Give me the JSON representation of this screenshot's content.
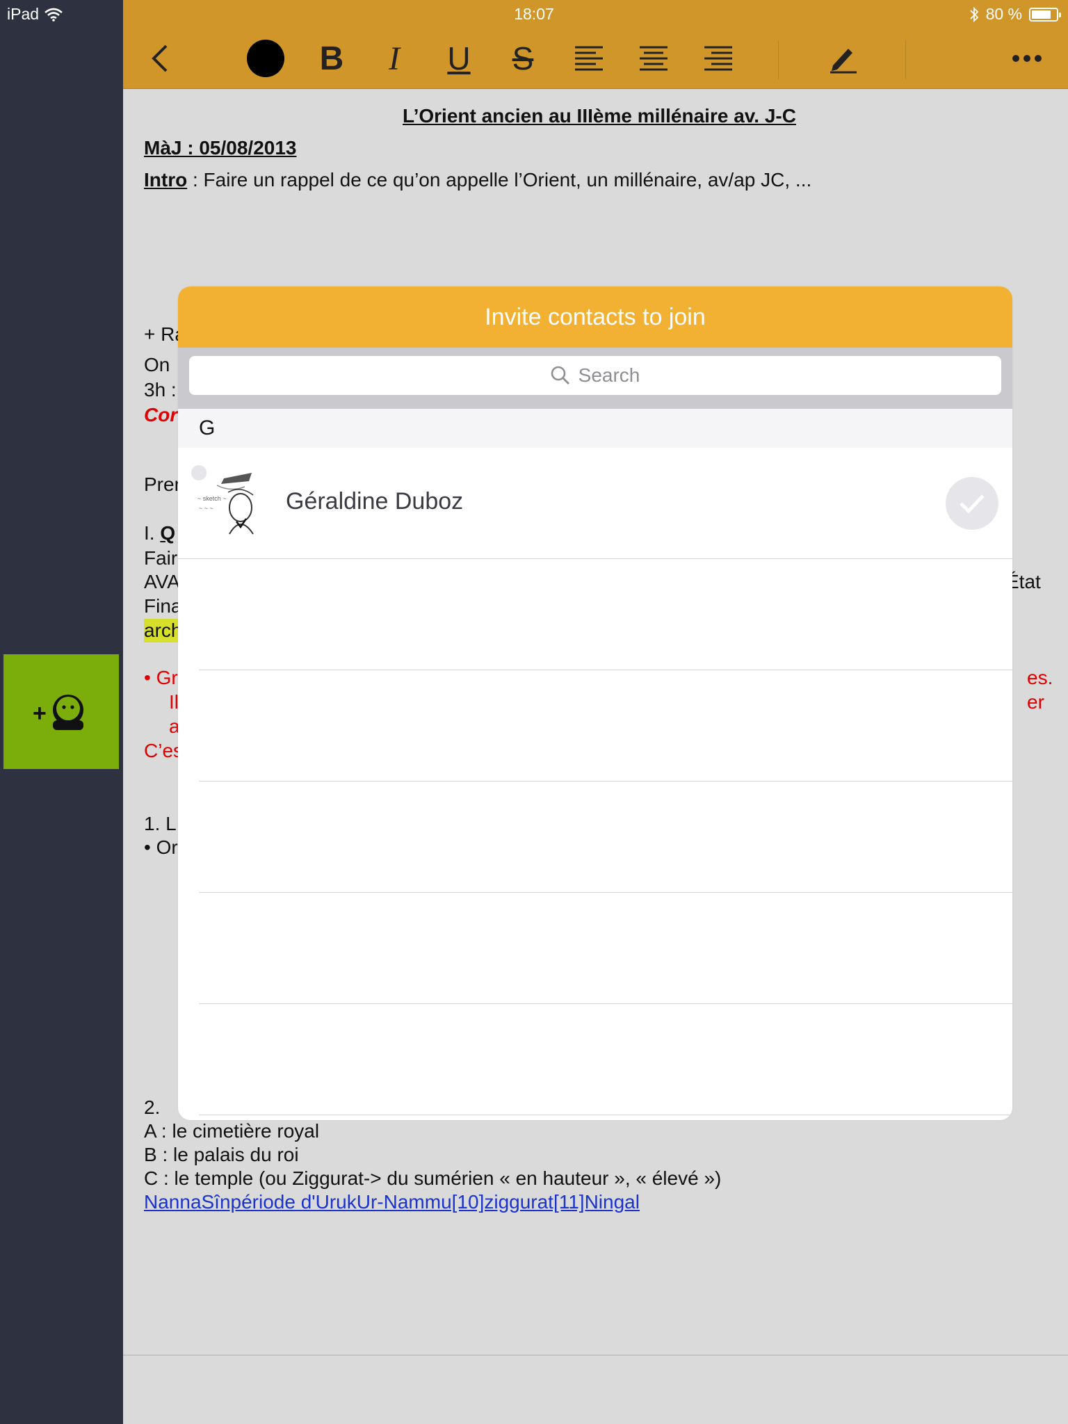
{
  "statusbar": {
    "carrier": "iPad",
    "time": "18:07",
    "battery_text": "80 %",
    "battery_level": 0.8
  },
  "toolbar": {
    "back_icon": "chevron-left-icon",
    "color_icon": "color-circle-icon",
    "bold_label": "B",
    "italic_label": "I",
    "underline_label": "U",
    "strike_label": "S",
    "align_left_icon": "align-left-icon",
    "align_center_icon": "align-center-icon",
    "align_right_icon": "align-right-icon",
    "pen_icon": "pen-icon",
    "more_icon": "more-icon"
  },
  "sidebar": {
    "invite_icon": "add-contact-icon",
    "accent": "#7bad0b"
  },
  "document": {
    "title": "L’Orient ancien au IIIème millénaire av. J-C",
    "update_label": "MàJ : 05/08/2013",
    "intro_label": "Intro",
    "intro_text": " : Faire un rappel de ce qu’on appelle l’Orient, un millénaire, av/ap JC, ...",
    "frag_ra": "+ Ra",
    "frag_on": "On",
    "frag_3h": "3h :",
    "frag_cor": "Cor",
    "frag_prem": "Prem",
    "frag_i": "I. ",
    "frag_q": "Q",
    "frag_fair": "Fair",
    "frag_ava": "AVA",
    "frag_etat": "État",
    "frag_fina": "Fina",
    "frag_arch": "arch",
    "frag_gr": "• Gr",
    "frag_es": "es.",
    "frag_il": "Il",
    "frag_er": "er",
    "frag_a": "a",
    "frag_cest": "C’es",
    "frag_1l": "1. L",
    "frag_or": "• Or",
    "item_2": "2.",
    "item_a": "A : le cimetière royal",
    "item_b": "B : le palais du roi",
    "item_c": "C : le temple (ou Ziggurat-> du sumérien « en hauteur », « élevé »)",
    "link_text": "NannaSînpériode d'UrukUr-Nammu[10]ziggurat[11]Ningal"
  },
  "modal": {
    "title": "Invite contacts to join",
    "search_placeholder": "Search",
    "section_letter": "G",
    "contacts": [
      {
        "name": "Géraldine Duboz",
        "avatar_icon": "sketch-avatar-icon",
        "selected": false
      }
    ],
    "empty_rows": 5
  }
}
